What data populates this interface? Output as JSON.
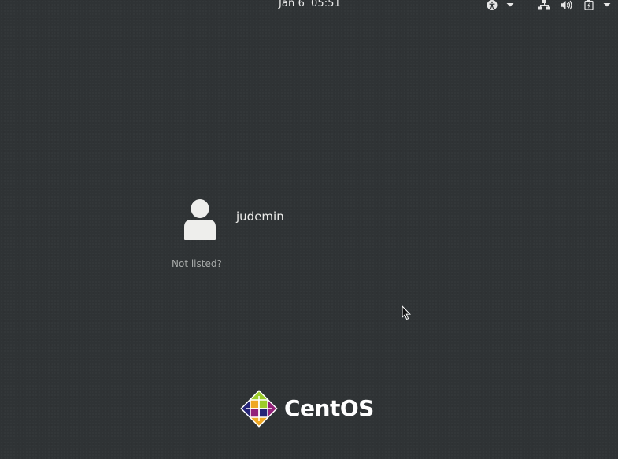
{
  "topbar": {
    "date": "Jan 6",
    "time": "05:51",
    "tray": [
      {
        "name": "accessibility-icon"
      },
      {
        "name": "chevron-down-icon"
      },
      {
        "name": "network-wired-icon"
      },
      {
        "name": "volume-icon"
      },
      {
        "name": "battery-charging-icon"
      },
      {
        "name": "chevron-down-icon"
      }
    ]
  },
  "login": {
    "username": "judemin",
    "not_listed_label": "Not listed?"
  },
  "branding": {
    "logo_text": "CentOS",
    "colors": {
      "yellow": "#efa724",
      "green": "#9ccd2a",
      "purple": "#932279",
      "blue": "#262577"
    }
  },
  "colors": {
    "background": "#2f3335",
    "text": "#eeeeec",
    "muted_text": "#a6a9a8"
  }
}
